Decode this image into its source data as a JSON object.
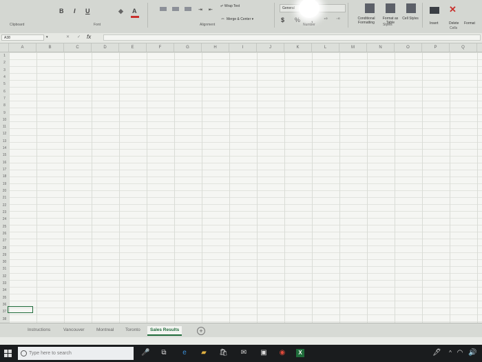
{
  "ribbon": {
    "clipboard_label": "Clipboard",
    "font_label": "Font",
    "font_buttons": [
      "B",
      "I",
      "U"
    ],
    "alignment_label": "Alignment",
    "wrap_text": "Wrap Text",
    "merge_center": "Merge & Center",
    "number_format": "General",
    "currency_symbol": "$",
    "percent_symbol": "%",
    "number_label": "Number",
    "conditional_formatting": "Conditional Formatting",
    "format_as_table": "Format as Table",
    "cell_styles": "Cell Styles",
    "styles_label": "Styles",
    "insert": "Insert",
    "delete": "Delete",
    "format": "Format",
    "cells_label": "Cells"
  },
  "formula_bar": {
    "name_box": "A38",
    "fx": "fx",
    "value": ""
  },
  "grid": {
    "columns": [
      "A",
      "B",
      "C",
      "D",
      "E",
      "F",
      "G",
      "H",
      "I",
      "J",
      "K",
      "L",
      "M",
      "N",
      "O",
      "P",
      "Q",
      "R"
    ],
    "rows": [
      "1",
      "2",
      "3",
      "4",
      "5",
      "6",
      "7",
      "8",
      "9",
      "10",
      "11",
      "12",
      "13",
      "14",
      "15",
      "16",
      "17",
      "18",
      "19",
      "20",
      "21",
      "22",
      "23",
      "24",
      "25",
      "26",
      "27",
      "28",
      "29",
      "30",
      "31",
      "32",
      "33",
      "34",
      "35",
      "36",
      "37",
      "38"
    ]
  },
  "sheet_tabs": [
    {
      "label": "Instructions",
      "active": false
    },
    {
      "label": "Vancouver",
      "active": false
    },
    {
      "label": "Montreal",
      "active": false
    },
    {
      "label": "Toronto",
      "active": false
    },
    {
      "label": "Sales Results",
      "active": true
    }
  ],
  "add_sheet_symbol": "+",
  "taskbar": {
    "search_placeholder": "Type here to search"
  },
  "colors": {
    "excel_green": "#1f6b3a",
    "taskbar": "#1a1c1e"
  }
}
